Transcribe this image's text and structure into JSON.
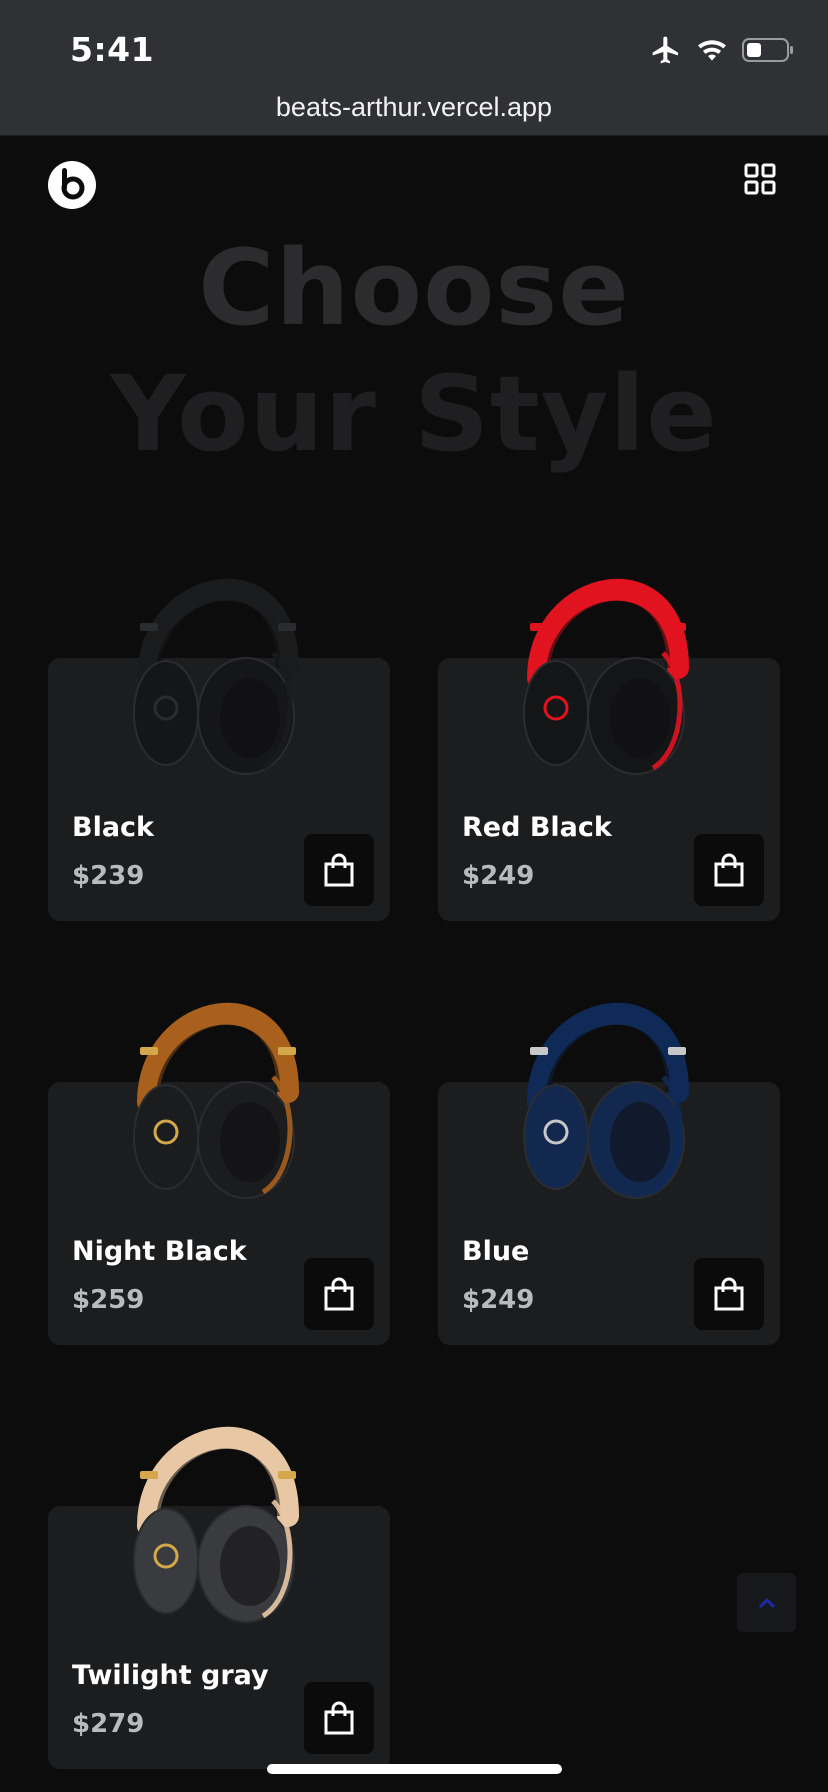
{
  "status_bar": {
    "time": "5:41"
  },
  "browser": {
    "url": "beats-arthur.vercel.app"
  },
  "hero": {
    "line1": "Choose",
    "line2": "Your Style"
  },
  "products": [
    {
      "name": "Black",
      "price": "$239",
      "band": "#1a1b1d",
      "cup": "#151618",
      "accent": "#2a2b2e"
    },
    {
      "name": "Red Black",
      "price": "$249",
      "band": "#e0131f",
      "cup": "#141517",
      "accent": "#e0131f"
    },
    {
      "name": "Night Black",
      "price": "$259",
      "band": "#a8601c",
      "cup": "#1b1c1e",
      "accent": "#d4a84a"
    },
    {
      "name": "Blue",
      "price": "$249",
      "band": "#0f2a57",
      "cup": "#13284f",
      "accent": "#c8c8c8"
    },
    {
      "name": "Twilight gray",
      "price": "$279",
      "band": "#e8c7a4",
      "cup": "#3a3b3e",
      "accent": "#d4a84a"
    }
  ],
  "icons": {
    "logo": "beats-logo-icon",
    "menu": "grid-menu-icon",
    "cart": "shopping-bag-icon",
    "scroll_top": "chevron-up-icon"
  },
  "colors": {
    "background": "#0c0c0d",
    "card": "#1c1d1f",
    "up_arrow": "#1d2aa8"
  }
}
